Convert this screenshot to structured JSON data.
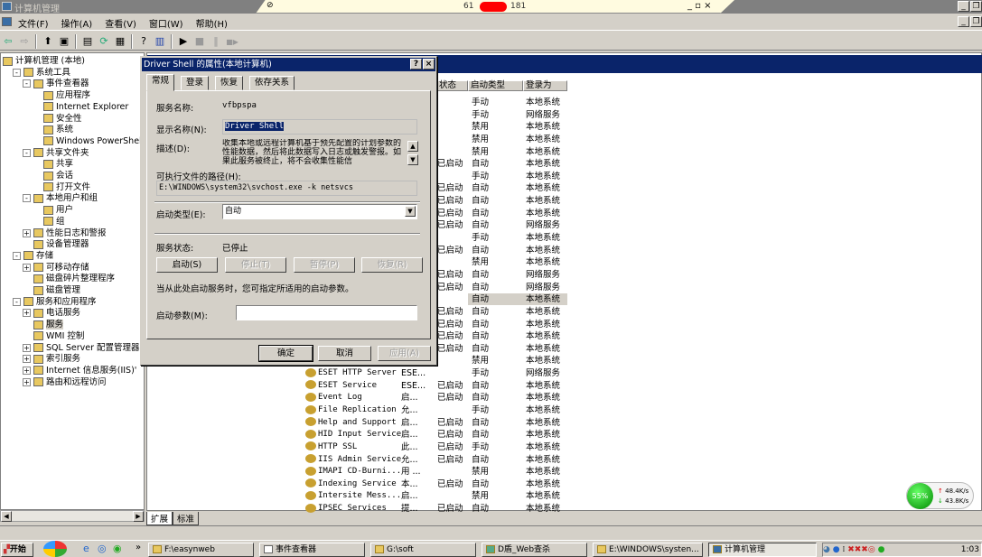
{
  "window": {
    "title": "计算机管理",
    "remote_bar": {
      "ip_prefix": "61",
      "ip_suffix": "181",
      "controls": "_ ▫ ×"
    }
  },
  "menu": [
    "文件(F)",
    "操作(A)",
    "查看(V)",
    "窗口(W)",
    "帮助(H)"
  ],
  "toolbar": {
    "icons": [
      "back-icon",
      "forward-icon",
      "up-folder-icon",
      "show-tree-icon",
      "properties-icon",
      "refresh-icon",
      "export-icon",
      "help-icon",
      "console-icon",
      "play-icon",
      "stop-icon",
      "pause-icon",
      "restart-icon"
    ],
    "glyphs": [
      "⇦",
      "⇨",
      "⬆",
      "▣",
      "▤",
      "⟳",
      "▦",
      "?",
      "▥",
      "▶",
      "■",
      "‖",
      "■▶"
    ]
  },
  "tree": [
    {
      "label": "计算机管理 (本地)",
      "level": 0,
      "pm": ""
    },
    {
      "label": "系统工具",
      "level": 1,
      "pm": "-"
    },
    {
      "label": "事件查看器",
      "level": 2,
      "pm": "-"
    },
    {
      "label": "应用程序",
      "level": 3,
      "pm": ""
    },
    {
      "label": "Internet Explorer",
      "level": 3,
      "pm": ""
    },
    {
      "label": "安全性",
      "level": 3,
      "pm": ""
    },
    {
      "label": "系统",
      "level": 3,
      "pm": ""
    },
    {
      "label": "Windows PowerShell",
      "level": 3,
      "pm": ""
    },
    {
      "label": "共享文件夹",
      "level": 2,
      "pm": "-"
    },
    {
      "label": "共享",
      "level": 3,
      "pm": ""
    },
    {
      "label": "会话",
      "level": 3,
      "pm": ""
    },
    {
      "label": "打开文件",
      "level": 3,
      "pm": ""
    },
    {
      "label": "本地用户和组",
      "level": 2,
      "pm": "-"
    },
    {
      "label": "用户",
      "level": 3,
      "pm": ""
    },
    {
      "label": "组",
      "level": 3,
      "pm": ""
    },
    {
      "label": "性能日志和警报",
      "level": 2,
      "pm": "+"
    },
    {
      "label": "设备管理器",
      "level": 2,
      "pm": ""
    },
    {
      "label": "存储",
      "level": 1,
      "pm": "-"
    },
    {
      "label": "可移动存储",
      "level": 2,
      "pm": "+"
    },
    {
      "label": "磁盘碎片整理程序",
      "level": 2,
      "pm": ""
    },
    {
      "label": "磁盘管理",
      "level": 2,
      "pm": ""
    },
    {
      "label": "服务和应用程序",
      "level": 1,
      "pm": "-"
    },
    {
      "label": "电话服务",
      "level": 2,
      "pm": "+"
    },
    {
      "label": "服务",
      "level": 2,
      "pm": "",
      "selected": true
    },
    {
      "label": "WMI 控制",
      "level": 2,
      "pm": ""
    },
    {
      "label": "SQL Server 配置管理器",
      "level": 2,
      "pm": "+"
    },
    {
      "label": "索引服务",
      "level": 2,
      "pm": "+"
    },
    {
      "label": "Internet 信息服务(IIS)'",
      "level": 2,
      "pm": "+"
    },
    {
      "label": "路由和远程访问",
      "level": 2,
      "pm": "+"
    }
  ],
  "services": {
    "columns": [
      "状态",
      "启动类型",
      "登录为"
    ],
    "rows": [
      {
        "name": "",
        "desc": "",
        "status": "",
        "startup": "手动",
        "logon": "本地系统"
      },
      {
        "name": "",
        "desc": "",
        "status": "",
        "startup": "手动",
        "logon": "网络服务"
      },
      {
        "name": "",
        "desc": "",
        "status": "",
        "startup": "禁用",
        "logon": "本地系统"
      },
      {
        "name": "",
        "desc": "",
        "status": "",
        "startup": "禁用",
        "logon": "本地系统"
      },
      {
        "name": "",
        "desc": "",
        "status": "",
        "startup": "禁用",
        "logon": "本地系统"
      },
      {
        "name": "",
        "desc": "",
        "status": "已启动",
        "startup": "自动",
        "logon": "本地系统"
      },
      {
        "name": "",
        "desc": "",
        "status": "",
        "startup": "手动",
        "logon": "本地系统"
      },
      {
        "name": "",
        "desc": "",
        "status": "已启动",
        "startup": "自动",
        "logon": "本地系统"
      },
      {
        "name": "",
        "desc": "",
        "status": "已启动",
        "startup": "自动",
        "logon": "本地系统"
      },
      {
        "name": "",
        "desc": "",
        "status": "已启动",
        "startup": "自动",
        "logon": "本地系统"
      },
      {
        "name": "",
        "desc": "",
        "status": "已启动",
        "startup": "自动",
        "logon": "网络服务"
      },
      {
        "name": "",
        "desc": "",
        "status": "",
        "startup": "手动",
        "logon": "本地系统"
      },
      {
        "name": "",
        "desc": "",
        "status": "已启动",
        "startup": "自动",
        "logon": "本地系统"
      },
      {
        "name": "",
        "desc": "",
        "status": "",
        "startup": "禁用",
        "logon": "本地系统"
      },
      {
        "name": "",
        "desc": "",
        "status": "已启动",
        "startup": "自动",
        "logon": "网络服务"
      },
      {
        "name": "",
        "desc": "",
        "status": "已启动",
        "startup": "自动",
        "logon": "网络服务"
      },
      {
        "name": "",
        "desc": "",
        "status": "",
        "startup": "自动",
        "logon": "本地系统",
        "selected": true
      },
      {
        "name": "",
        "desc": "",
        "status": "已启动",
        "startup": "自动",
        "logon": "本地系统"
      },
      {
        "name": "",
        "desc": "",
        "status": "已启动",
        "startup": "自动",
        "logon": "本地系统"
      },
      {
        "name": "",
        "desc": "",
        "status": "已启动",
        "startup": "自动",
        "logon": "本地系统"
      },
      {
        "name": "",
        "desc": "",
        "status": "已启动",
        "startup": "自动",
        "logon": "本地系统"
      },
      {
        "name": "",
        "desc": "",
        "status": "",
        "startup": "禁用",
        "logon": "本地系统"
      },
      {
        "name": "ESET HTTP Server",
        "desc": "ESE...",
        "status": "",
        "startup": "手动",
        "logon": "网络服务"
      },
      {
        "name": "ESET Service",
        "desc": "ESE...",
        "status": "已启动",
        "startup": "自动",
        "logon": "本地系统"
      },
      {
        "name": "Event Log",
        "desc": "启...",
        "status": "已启动",
        "startup": "自动",
        "logon": "本地系统"
      },
      {
        "name": "File Replication",
        "desc": "允...",
        "status": "",
        "startup": "手动",
        "logon": "本地系统"
      },
      {
        "name": "Help and Support",
        "desc": "启...",
        "status": "已启动",
        "startup": "自动",
        "logon": "本地系统"
      },
      {
        "name": "HID Input Service",
        "desc": "启...",
        "status": "已启动",
        "startup": "自动",
        "logon": "本地系统"
      },
      {
        "name": "HTTP SSL",
        "desc": "此...",
        "status": "已启动",
        "startup": "手动",
        "logon": "本地系统"
      },
      {
        "name": "IIS Admin Service",
        "desc": "允...",
        "status": "已启动",
        "startup": "自动",
        "logon": "本地系统"
      },
      {
        "name": "IMAPI CD-Burni...",
        "desc": "用 ...",
        "status": "",
        "startup": "禁用",
        "logon": "本地系统"
      },
      {
        "name": "Indexing Service",
        "desc": "本...",
        "status": "已启动",
        "startup": "自动",
        "logon": "本地系统"
      },
      {
        "name": "Intersite Mess...",
        "desc": "启...",
        "status": "",
        "startup": "禁用",
        "logon": "本地系统"
      },
      {
        "name": "IPSEC Services",
        "desc": "提...",
        "status": "已启动",
        "startup": "自动",
        "logon": "本地系统"
      }
    ]
  },
  "view_tabs": [
    "扩展",
    "标准"
  ],
  "dialog": {
    "title": "Driver Shell 的属性(本地计算机)",
    "help": "?",
    "close": "×",
    "tabs": [
      "常规",
      "登录",
      "恢复",
      "依存关系"
    ],
    "service_name_label": "服务名称:",
    "service_name": "vfbpspa",
    "display_name_label": "显示名称(N):",
    "display_name": "Driver Shell",
    "description_label": "描述(D):",
    "description": "收集本地或远程计算机基于预先配置的计划参数的性能数据，然后将此数据写入日志或触发警报。如果此服务被终止，将不会收集性能信",
    "path_label": "可执行文件的路径(H):",
    "path": "E:\\WINDOWS\\system32\\svchost.exe -k netsvcs",
    "startup_type_label": "启动类型(E):",
    "startup_type": "自动",
    "status_label": "服务状态:",
    "status": "已停止",
    "buttons": {
      "start": "启动(S)",
      "stop": "停止(T)",
      "pause": "暂停(P)",
      "resume": "恢复(R)"
    },
    "hint": "当从此处启动服务时，您可指定所适用的启动参数。",
    "params_label": "启动参数(M):",
    "params_value": "",
    "ok": "确定",
    "cancel": "取消",
    "apply": "应用(A)"
  },
  "net_widget": {
    "percent": "55%",
    "up": "48.4K/s",
    "down": "43.8K/s"
  },
  "taskbar": {
    "start": "开始",
    "tasks": [
      "F:\\easynweb",
      "事件查看器",
      "G:\\soft",
      "D盾_Web查杀",
      "E:\\WINDOWS\\systen...",
      "计算机管理"
    ],
    "clock": "1:03"
  }
}
